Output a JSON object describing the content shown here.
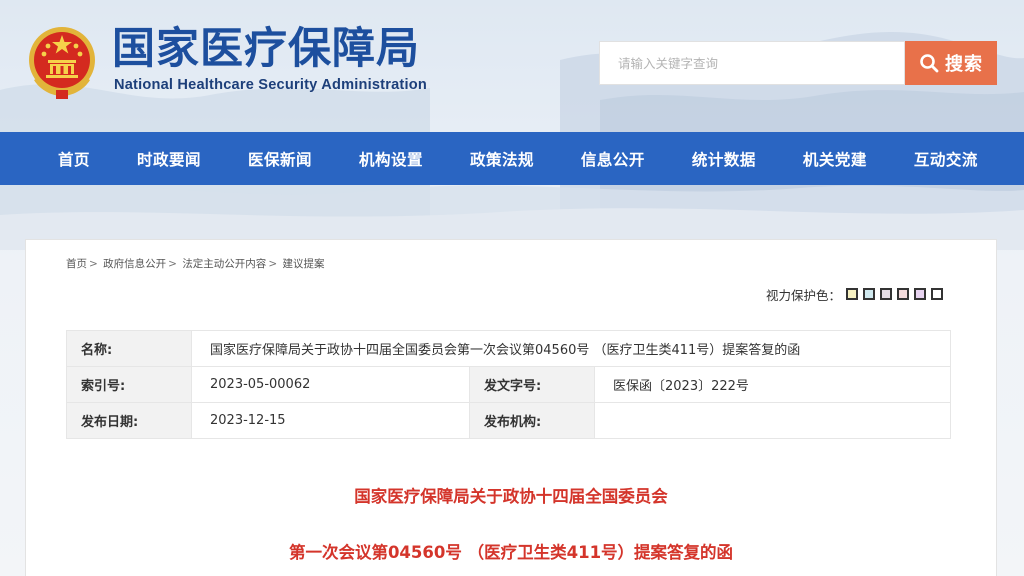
{
  "header": {
    "title_cn": "国家医疗保障局",
    "title_en": "National Healthcare Security Administration"
  },
  "search": {
    "placeholder": "请输入关键字查询",
    "button_label": "搜索"
  },
  "nav": {
    "items": [
      "首页",
      "时政要闻",
      "医保新闻",
      "机构设置",
      "政策法规",
      "信息公开",
      "统计数据",
      "机关党建",
      "互动交流"
    ]
  },
  "breadcrumb": {
    "items": [
      "首页",
      "政府信息公开",
      "法定主动公开内容",
      "建议提案"
    ],
    "separator": ">"
  },
  "vision": {
    "label": "视力保护色：",
    "swatches": [
      "#f7f1c2",
      "#cfe8ee",
      "#e5dde5",
      "#f3dadb",
      "#e7d3f0",
      "#ffffff"
    ]
  },
  "meta": {
    "name_label": "名称:",
    "name_value": "国家医疗保障局关于政协十四届全国委员会第一次会议第04560号 （医疗卫生类411号）提案答复的函",
    "index_label": "索引号:",
    "index_value": "2023-05-00062",
    "doc_no_label": "发文字号:",
    "doc_no_value": "医保函〔2023〕222号",
    "date_label": "发布日期:",
    "date_value": "2023-12-15",
    "org_label": "发布机构:",
    "org_value": ""
  },
  "document": {
    "title_line1": "国家医疗保障局关于政协十四届全国委员会",
    "title_line2": "第一次会议第04560号 （医疗卫生类411号）提案答复的函"
  },
  "colors": {
    "brand_blue": "#2a65c2",
    "title_blue": "#1d4f9e",
    "search_orange": "#e8714a",
    "doc_title_red": "#d4352b"
  }
}
